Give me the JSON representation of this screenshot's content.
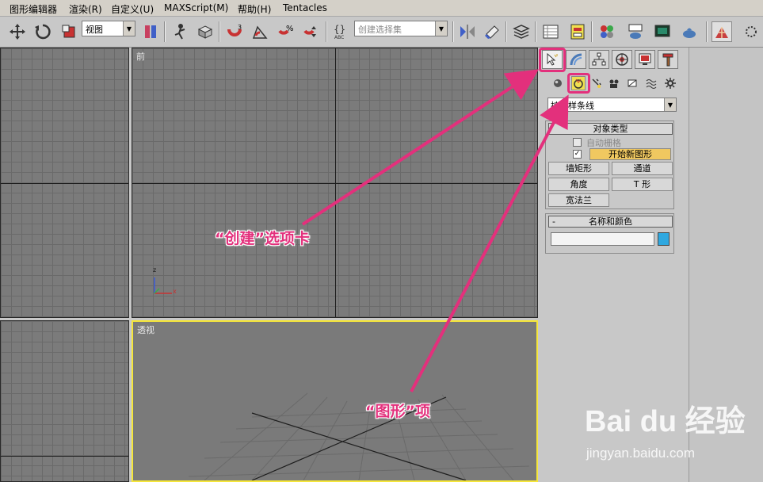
{
  "menu": {
    "items": [
      "图形编辑器",
      "渲染(R)",
      "自定义(U)",
      "MAXScript(M)",
      "帮助(H)",
      "Tentacles"
    ]
  },
  "toolbar": {
    "view_dropdown": "视图",
    "selection_set_placeholder": "创建选择集"
  },
  "viewports": {
    "front_label": "前",
    "perspective_label": "透视",
    "axis_z": "z",
    "axis_x": "x",
    "colors": {
      "grid_bg": "#7b7b7b",
      "active_border": "#f5e63a",
      "axis_y": "#3aa84a",
      "axis_x_color": "#c83232",
      "axis_z_color": "#3a5ad8"
    }
  },
  "command_panel": {
    "tabs": [
      "create-tab",
      "modify-tab",
      "hierarchy-tab",
      "motion-tab",
      "display-tab",
      "utilities-tab"
    ],
    "subtabs": [
      "geometry-icon",
      "shapes-icon",
      "lights-icon",
      "cameras-icon",
      "helpers-icon",
      "space-warps-icon",
      "systems-icon"
    ],
    "category_dropdown": "扩展样条线",
    "object_type": {
      "title": "对象类型",
      "autogrid_label": "自动栅格",
      "start_new_shape_label": "开始新图形",
      "start_new_shape_checked": true,
      "buttons": [
        "墙矩形",
        "通道",
        "角度",
        "T 形",
        "宽法兰"
      ]
    },
    "name_color": {
      "title": "名称和颜色",
      "collapse_symbol": "-",
      "name_value": "",
      "swatch_color": "#2fa8e0"
    },
    "highlight_color": "#e3307c"
  },
  "annotations": {
    "create_tab": "“创建”选项卡",
    "shapes": "“图形”项"
  },
  "watermark": {
    "brand": "Bai du 经验",
    "url": "jingyan.baidu.com"
  }
}
